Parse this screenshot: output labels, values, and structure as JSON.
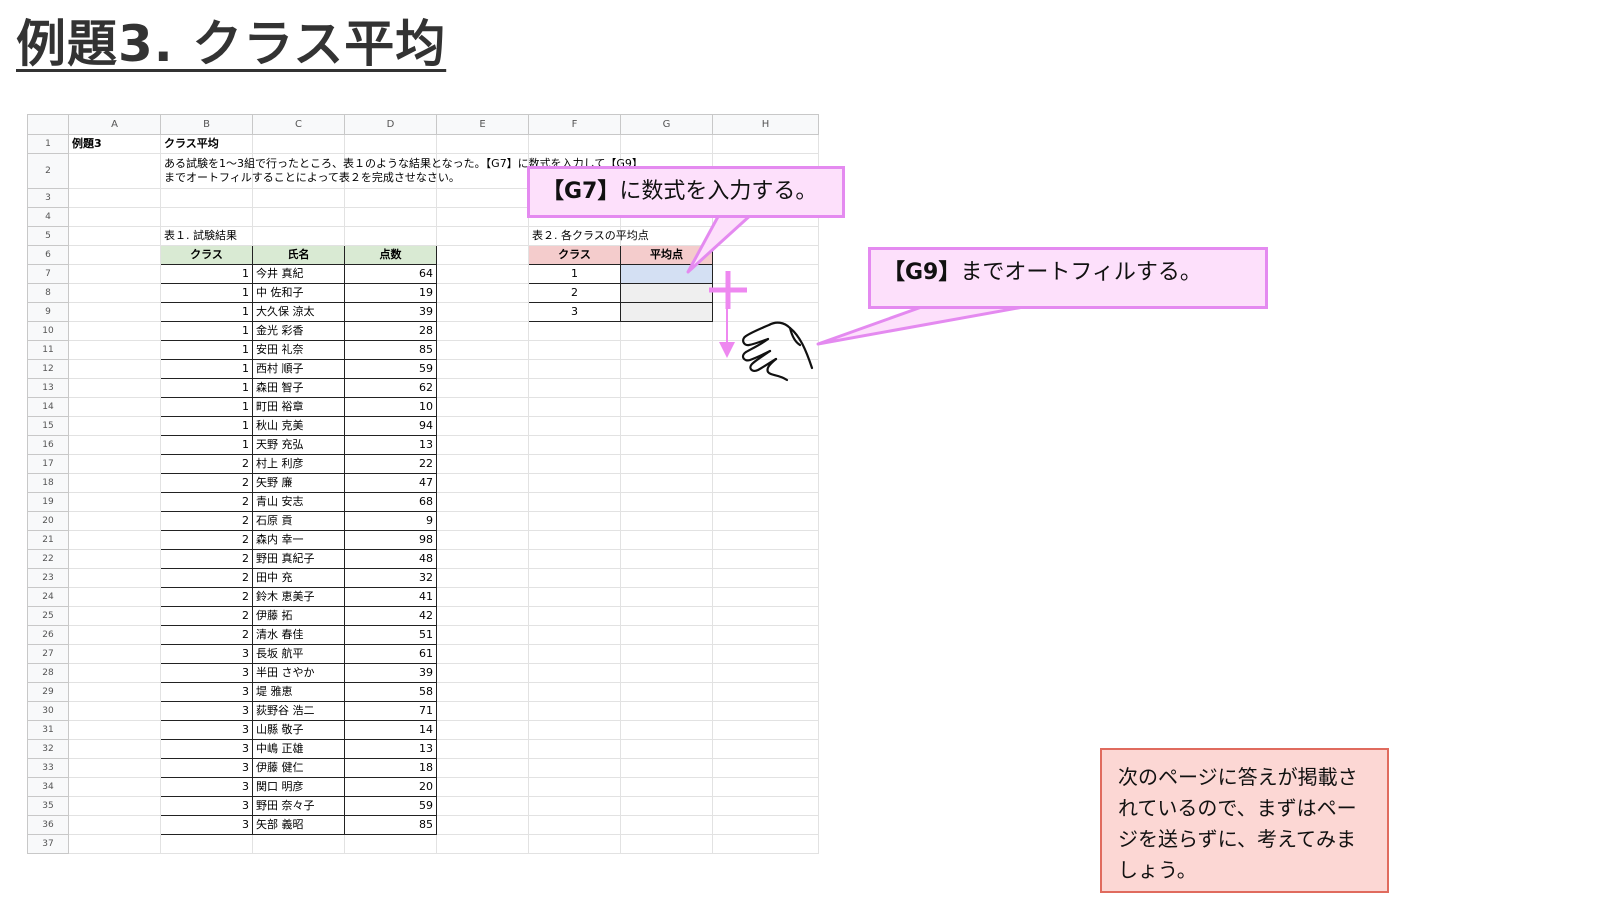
{
  "title": "例題3. クラス平均",
  "sheet": {
    "columns": [
      "A",
      "B",
      "C",
      "D",
      "E",
      "F",
      "G",
      "H"
    ],
    "row_numbers": [
      "1",
      "2",
      "3",
      "4",
      "5",
      "6",
      "7",
      "8",
      "9",
      "10",
      "11",
      "12",
      "13",
      "14",
      "15",
      "16",
      "17",
      "18",
      "19",
      "20",
      "21",
      "22",
      "23",
      "24",
      "25",
      "26",
      "27",
      "28",
      "29",
      "30",
      "31",
      "32",
      "33",
      "34",
      "35",
      "36",
      "37"
    ],
    "a1": "例題3",
    "b1": "クラス平均",
    "b2_line1": "ある試験を1〜3組で行ったところ、表１のような結果となった。【G7】に数式を入力して【G9】",
    "b2_line2": "までオートフィルすることによって表２を完成させなさい。",
    "table1": {
      "caption": "表１. 試験結果",
      "headers": [
        "クラス",
        "氏名",
        "点数"
      ],
      "rows": [
        [
          "1",
          "今井 真紀",
          "64"
        ],
        [
          "1",
          "中 佐和子",
          "19"
        ],
        [
          "1",
          "大久保 涼太",
          "39"
        ],
        [
          "1",
          "金光 彩香",
          "28"
        ],
        [
          "1",
          "安田 礼奈",
          "85"
        ],
        [
          "1",
          "西村 順子",
          "59"
        ],
        [
          "1",
          "森田 智子",
          "62"
        ],
        [
          "1",
          "町田 裕章",
          "10"
        ],
        [
          "1",
          "秋山 克美",
          "94"
        ],
        [
          "1",
          "天野 充弘",
          "13"
        ],
        [
          "2",
          "村上 利彦",
          "22"
        ],
        [
          "2",
          "矢野 廉",
          "47"
        ],
        [
          "2",
          "青山 安志",
          "68"
        ],
        [
          "2",
          "石原 貢",
          "9"
        ],
        [
          "2",
          "森内 幸一",
          "98"
        ],
        [
          "2",
          "野田 真紀子",
          "48"
        ],
        [
          "2",
          "田中 充",
          "32"
        ],
        [
          "2",
          "鈴木 恵美子",
          "41"
        ],
        [
          "2",
          "伊藤 拓",
          "42"
        ],
        [
          "2",
          "清水 春佳",
          "51"
        ],
        [
          "3",
          "長坂 航平",
          "61"
        ],
        [
          "3",
          "半田 さやか",
          "39"
        ],
        [
          "3",
          "堤 雅恵",
          "58"
        ],
        [
          "3",
          "荻野谷 浩二",
          "71"
        ],
        [
          "3",
          "山縣 敬子",
          "14"
        ],
        [
          "3",
          "中嶋 正雄",
          "13"
        ],
        [
          "3",
          "伊藤 健仁",
          "18"
        ],
        [
          "3",
          "関口 明彦",
          "20"
        ],
        [
          "3",
          "野田 奈々子",
          "59"
        ],
        [
          "3",
          "矢部 義昭",
          "85"
        ]
      ]
    },
    "table2": {
      "caption": "表２. 各クラスの平均点",
      "headers": [
        "クラス",
        "平均点"
      ],
      "rows": [
        [
          "1",
          ""
        ],
        [
          "2",
          ""
        ],
        [
          "3",
          ""
        ]
      ]
    }
  },
  "callout1": {
    "key": "【G7】",
    "text": "に数式を入力する。"
  },
  "callout2": {
    "key": "【G9】",
    "text": "までオートフィルする。"
  },
  "note": "次のページに答えが掲載されているので、まずはページを送らずに、考えてみましょう。",
  "colors": {
    "callout_fill": "#fde0fb",
    "callout_border": "#e48af0",
    "note_fill": "#fcd7d4",
    "note_border": "#e06b5e",
    "header_green": "#d9ead3",
    "header_pink": "#f4cccc",
    "selected_cell": "#d4e0f3"
  },
  "icons": [
    "fill-handle-cross-icon",
    "autofill-down-arrow-icon",
    "pointing-hand-icon"
  ]
}
